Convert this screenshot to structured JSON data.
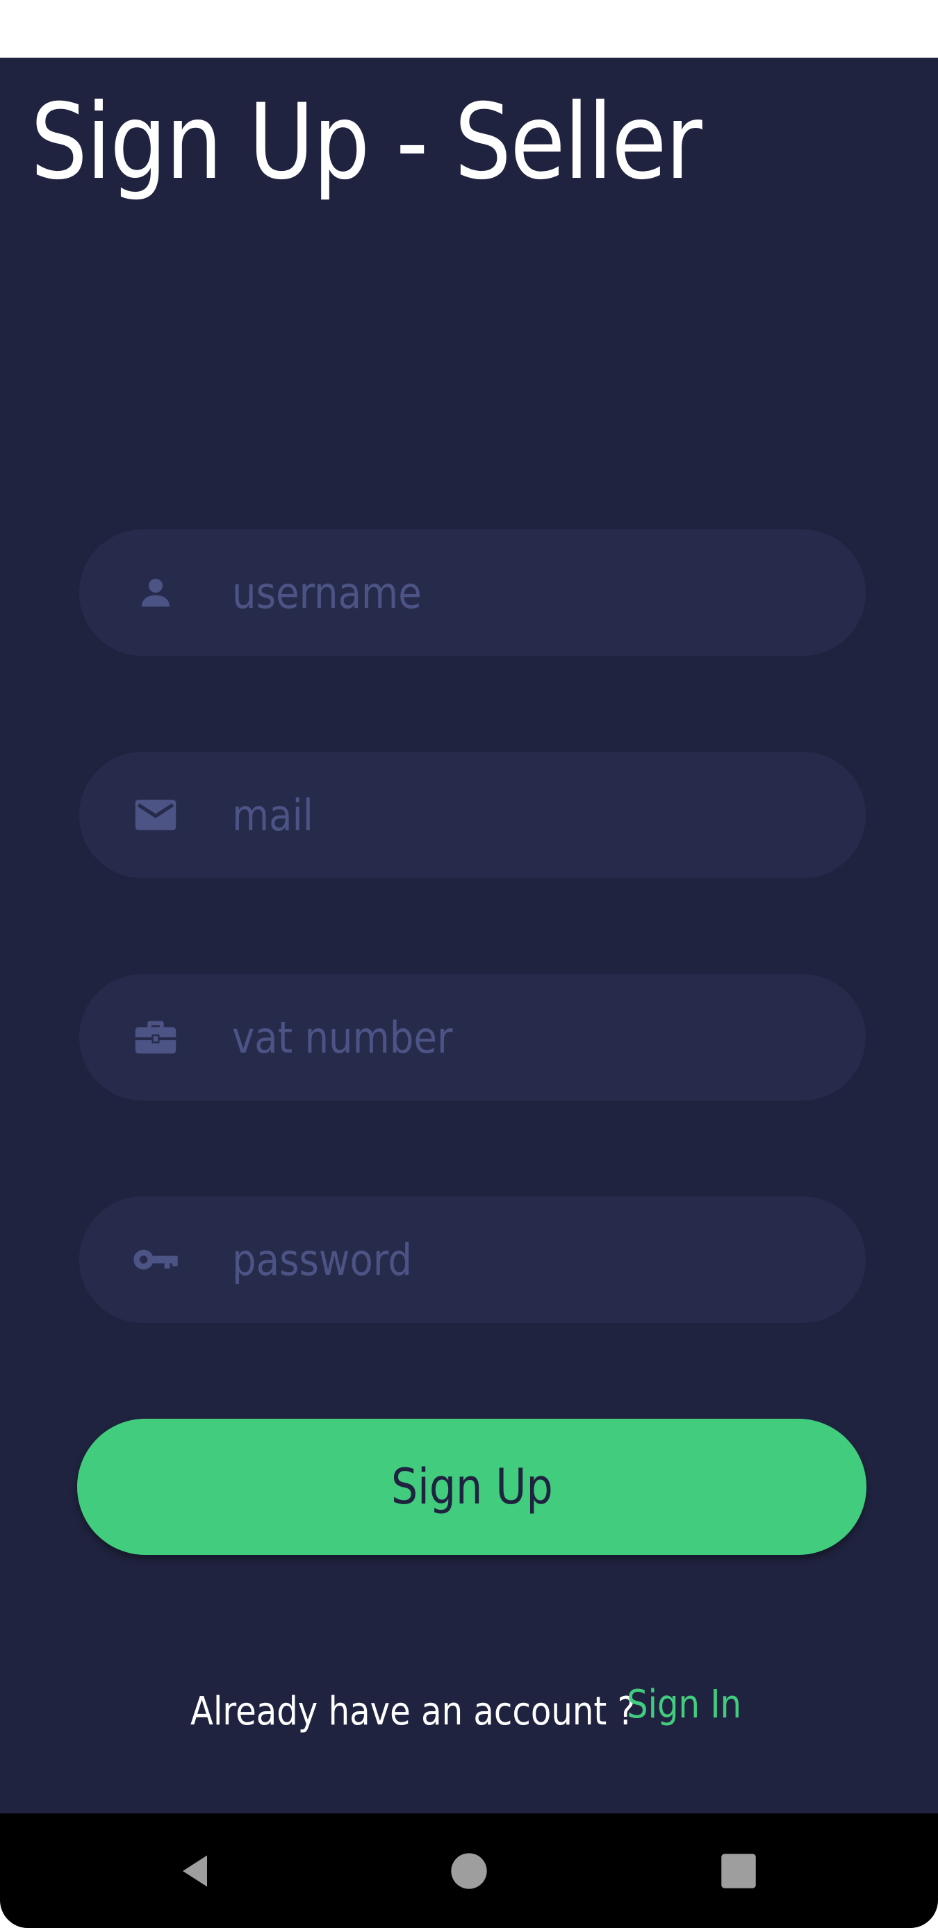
{
  "page": {
    "title": "Sign Up - Seller"
  },
  "form": {
    "fields": [
      {
        "id": "username",
        "icon": "person-icon",
        "placeholder": "username",
        "value": ""
      },
      {
        "id": "mail",
        "icon": "mail-icon",
        "placeholder": "mail",
        "value": ""
      },
      {
        "id": "vat",
        "icon": "briefcase-icon",
        "placeholder": "vat number",
        "value": ""
      },
      {
        "id": "password",
        "icon": "key-icon",
        "placeholder": "password",
        "value": ""
      }
    ],
    "submit_label": "Sign Up"
  },
  "footer": {
    "prompt": "Already have an account ?",
    "link_label": "Sign In"
  },
  "nav": {
    "back": "back-icon",
    "home": "home-icon",
    "recents": "recents-icon"
  },
  "colors": {
    "background": "#20233f",
    "field_background": "#272b4b",
    "placeholder": "#4c5385",
    "accent": "#41cc7e",
    "text": "#ffffff"
  }
}
